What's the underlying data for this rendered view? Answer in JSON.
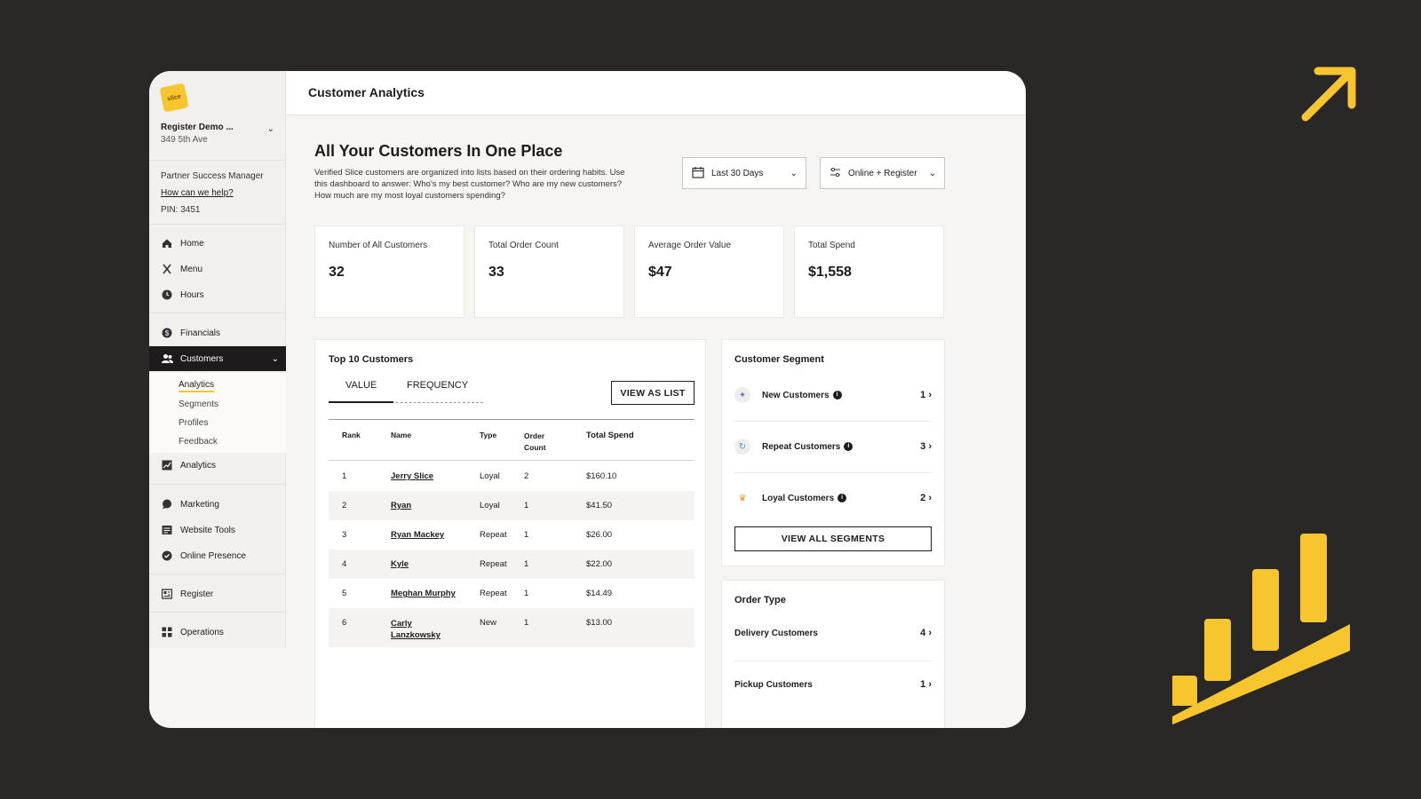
{
  "sidebar": {
    "store_name": "Register Demo ...",
    "store_address": "349 5th Ave",
    "psm_label": "Partner Success Manager",
    "psm_link": "How can we help?",
    "pin": "PIN: 3451",
    "nav": [
      {
        "label": "Home",
        "icon": "home-icon"
      },
      {
        "label": "Menu",
        "icon": "utensils-icon"
      },
      {
        "label": "Hours",
        "icon": "clock-icon"
      },
      {
        "label": "Financials",
        "icon": "dollar-icon"
      },
      {
        "label": "Customers",
        "icon": "users-icon"
      },
      {
        "label": "Analytics",
        "icon": "chart-icon"
      },
      {
        "label": "Marketing",
        "icon": "chat-icon"
      },
      {
        "label": "Website Tools",
        "icon": "website-icon"
      },
      {
        "label": "Online Presence",
        "icon": "check-circle-icon"
      },
      {
        "label": "Register",
        "icon": "register-icon"
      },
      {
        "label": "Operations",
        "icon": "grid-icon"
      }
    ],
    "subnav": [
      "Analytics",
      "Segments",
      "Profiles",
      "Feedback"
    ]
  },
  "header": {
    "title": "Customer Analytics"
  },
  "main": {
    "heading": "All Your Customers In One Place",
    "description": "Verified Slice customers are organized into lists based on their ordering habits. Use this dashboard to answer: Who's my best customer? Who are my new customers? How much are my most loyal customers spending?",
    "date_filter": "Last 30 Days",
    "channel_filter": "Online + Register"
  },
  "stats": [
    {
      "label": "Number of All Customers",
      "value": "32"
    },
    {
      "label": "Total Order Count",
      "value": "33"
    },
    {
      "label": "Average Order Value",
      "value": "$47"
    },
    {
      "label": "Total Spend",
      "value": "$1,558"
    }
  ],
  "top_customers": {
    "title": "Top 10 Customers",
    "tabs": [
      "VALUE",
      "FREQUENCY"
    ],
    "view_list": "VIEW AS LIST",
    "columns": [
      "Rank",
      "Name",
      "Type",
      "Order Count",
      "Total Spend"
    ],
    "rows": [
      {
        "rank": "1",
        "name": "Jerry Slice",
        "type": "Loyal",
        "count": "2",
        "spend": "$160.10"
      },
      {
        "rank": "2",
        "name": "Ryan",
        "type": "Loyal",
        "count": "1",
        "spend": "$41.50"
      },
      {
        "rank": "3",
        "name": "Ryan Mackey",
        "type": "Repeat",
        "count": "1",
        "spend": "$26.00"
      },
      {
        "rank": "4",
        "name": "Kyle",
        "type": "Repeat",
        "count": "1",
        "spend": "$22.00"
      },
      {
        "rank": "5",
        "name": "Meghan Murphy",
        "type": "Repeat",
        "count": "1",
        "spend": "$14.49"
      },
      {
        "rank": "6",
        "name": "Carly Lanzkowsky",
        "type": "New",
        "count": "1",
        "spend": "$13.00"
      }
    ]
  },
  "segments": {
    "title": "Customer Segment",
    "items": [
      {
        "label": "New Customers",
        "count": "1",
        "icon": "sparkle-icon"
      },
      {
        "label": "Repeat Customers",
        "count": "3",
        "icon": "repeat-icon"
      },
      {
        "label": "Loyal Customers",
        "count": "2",
        "icon": "crown-icon"
      }
    ],
    "button": "VIEW ALL SEGMENTS"
  },
  "order_type": {
    "title": "Order Type",
    "items": [
      {
        "label": "Delivery Customers",
        "count": "4"
      },
      {
        "label": "Pickup Customers",
        "count": "1"
      }
    ]
  },
  "colors": {
    "accent": "#f7c62f",
    "background": "#2a2727"
  }
}
